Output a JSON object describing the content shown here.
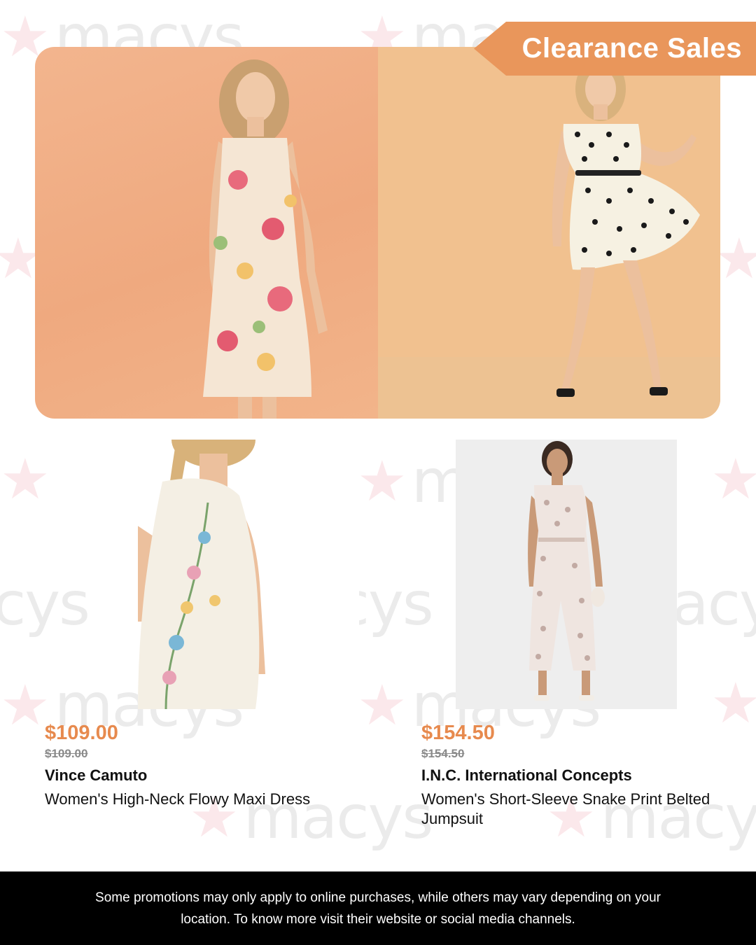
{
  "banner": {
    "tag_label": "Clearance Sales",
    "watermark_text": "macys"
  },
  "products": [
    {
      "price": "$109.00",
      "original_price": "$109.00",
      "brand": "Vince Camuto",
      "name": "Women's High-Neck Flowy Maxi Dress"
    },
    {
      "price": "$154.50",
      "original_price": "$154.50",
      "brand": "I.N.C. International Concepts",
      "name": "Women's Short-Sleeve Snake Print Belted Jumpsuit"
    }
  ],
  "footer": {
    "disclaimer": "Some promotions may only apply to online purchases, while others may vary depending on your location. To know more visit their website or social media channels."
  },
  "colors": {
    "accent": "#e9965b",
    "price": "#e78a4e",
    "footer_bg": "#000000"
  }
}
